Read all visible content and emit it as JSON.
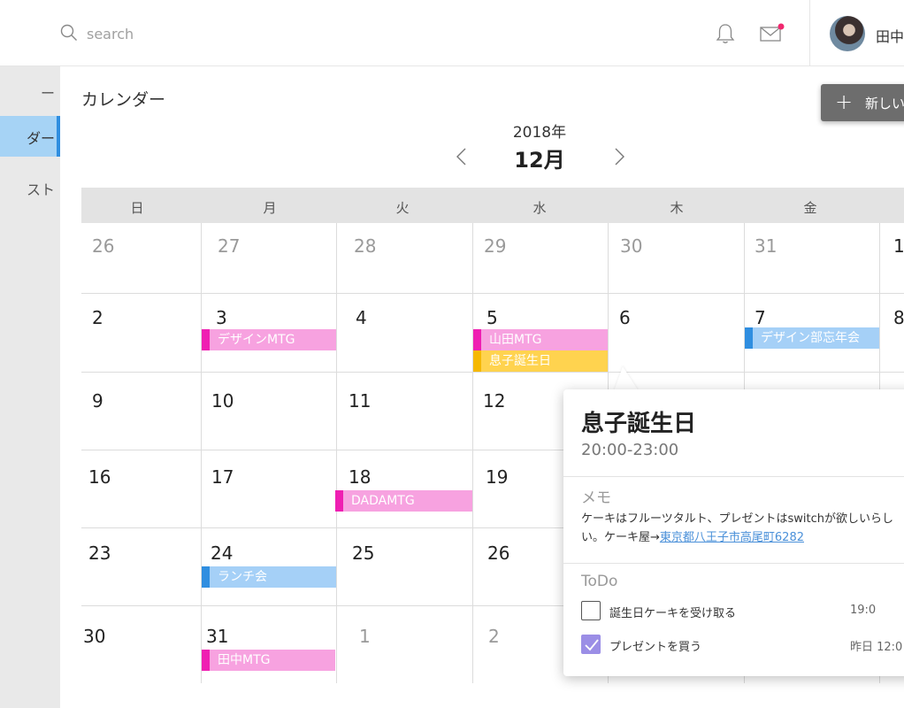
{
  "header": {
    "search_placeholder": "search",
    "user_name": "田中"
  },
  "sidebar": {
    "items": [
      {
        "label": "ー"
      },
      {
        "label": "ダー"
      },
      {
        "label": "スト"
      }
    ]
  },
  "main": {
    "title": "カレンダー",
    "new_button_label": "新しい",
    "year": "2018年",
    "month": "12月",
    "weekdays": [
      "日",
      "月",
      "火",
      "水",
      "木",
      "金"
    ]
  },
  "calendar": {
    "weeks": [
      [
        "26",
        "27",
        "28",
        "29",
        "30",
        "31",
        "1"
      ],
      [
        "2",
        "3",
        "4",
        "5",
        "6",
        "7",
        "8"
      ],
      [
        "9",
        "10",
        "11",
        "12",
        "",
        "",
        ""
      ],
      [
        "16",
        "17",
        "18",
        "19",
        "",
        "",
        ""
      ],
      [
        "23",
        "24",
        "25",
        "26",
        "",
        "",
        ""
      ],
      [
        "30",
        "31",
        "1",
        "2",
        "",
        "",
        ""
      ]
    ],
    "events": [
      {
        "label": "デザインMTG",
        "color": "#f7a2e0",
        "bar": "#ef1fb2"
      },
      {
        "label": "山田MTG",
        "color": "#f7a2e0",
        "bar": "#ef1fb2"
      },
      {
        "label": "息子誕生日",
        "color": "#ffd34f",
        "bar": "#f5b800"
      },
      {
        "label": "デザイン部忘年会",
        "color": "#a5d0f7",
        "bar": "#2f8ee0"
      },
      {
        "label": "DADAMTG",
        "color": "#f7a2e0",
        "bar": "#ef1fb2"
      },
      {
        "label": "ランチ会",
        "color": "#a5d0f7",
        "bar": "#2f8ee0"
      },
      {
        "label": "田中MTG",
        "color": "#f7a2e0",
        "bar": "#ef1fb2"
      }
    ]
  },
  "popup": {
    "title": "息子誕生日",
    "time": "20:00-23:00",
    "memo_heading": "メモ",
    "memo_text": "ケーキはフルーツタルト、プレゼントはswitchが欲しいらしい。ケーキ屋→",
    "memo_link": "東京都八王子市高尾町6282",
    "todo_heading": "ToDo",
    "todos": [
      {
        "label": "誕生日ケーキを受け取る",
        "time": "19:0",
        "checked": false
      },
      {
        "label": "プレゼントを買う",
        "time": "昨日 12:0",
        "checked": true
      }
    ]
  }
}
